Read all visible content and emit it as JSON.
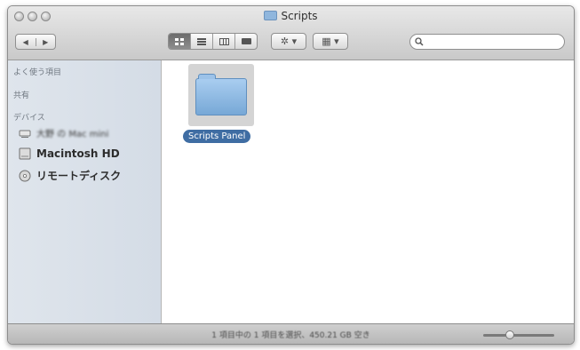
{
  "window": {
    "title": "Scripts"
  },
  "toolbar": {
    "nav_back": "◀",
    "nav_forward": "▶",
    "view_icons": [
      "icon-view-icon",
      "list-view-icon",
      "column-view-icon",
      "coverflow-view-icon"
    ],
    "action_label": "✲ ▾",
    "arrange_label": "▦ ▾",
    "search": {
      "value": "",
      "placeholder": ""
    }
  },
  "sidebar": {
    "favorites_header": "よく使う項目",
    "shared_header": "共有",
    "devices_header": "デバイス",
    "devices": [
      {
        "label": "大野 の Mac mini",
        "icon": "computer-icon"
      },
      {
        "label": "Macintosh HD",
        "icon": "hard-drive-icon"
      },
      {
        "label": "リモートディスク",
        "icon": "optical-disc-icon"
      }
    ]
  },
  "content": {
    "items": [
      {
        "name": "Scripts Panel",
        "icon": "folder-icon",
        "selected": true
      }
    ]
  },
  "statusbar": {
    "text": "1 項目中の 1 項目を選択、450.21 GB 空き",
    "zoom_level": 0.35
  },
  "colors": {
    "selection": "#3f6da3",
    "sidebar_bg": "#dbe2ea",
    "folder": "#8fb6dd"
  }
}
